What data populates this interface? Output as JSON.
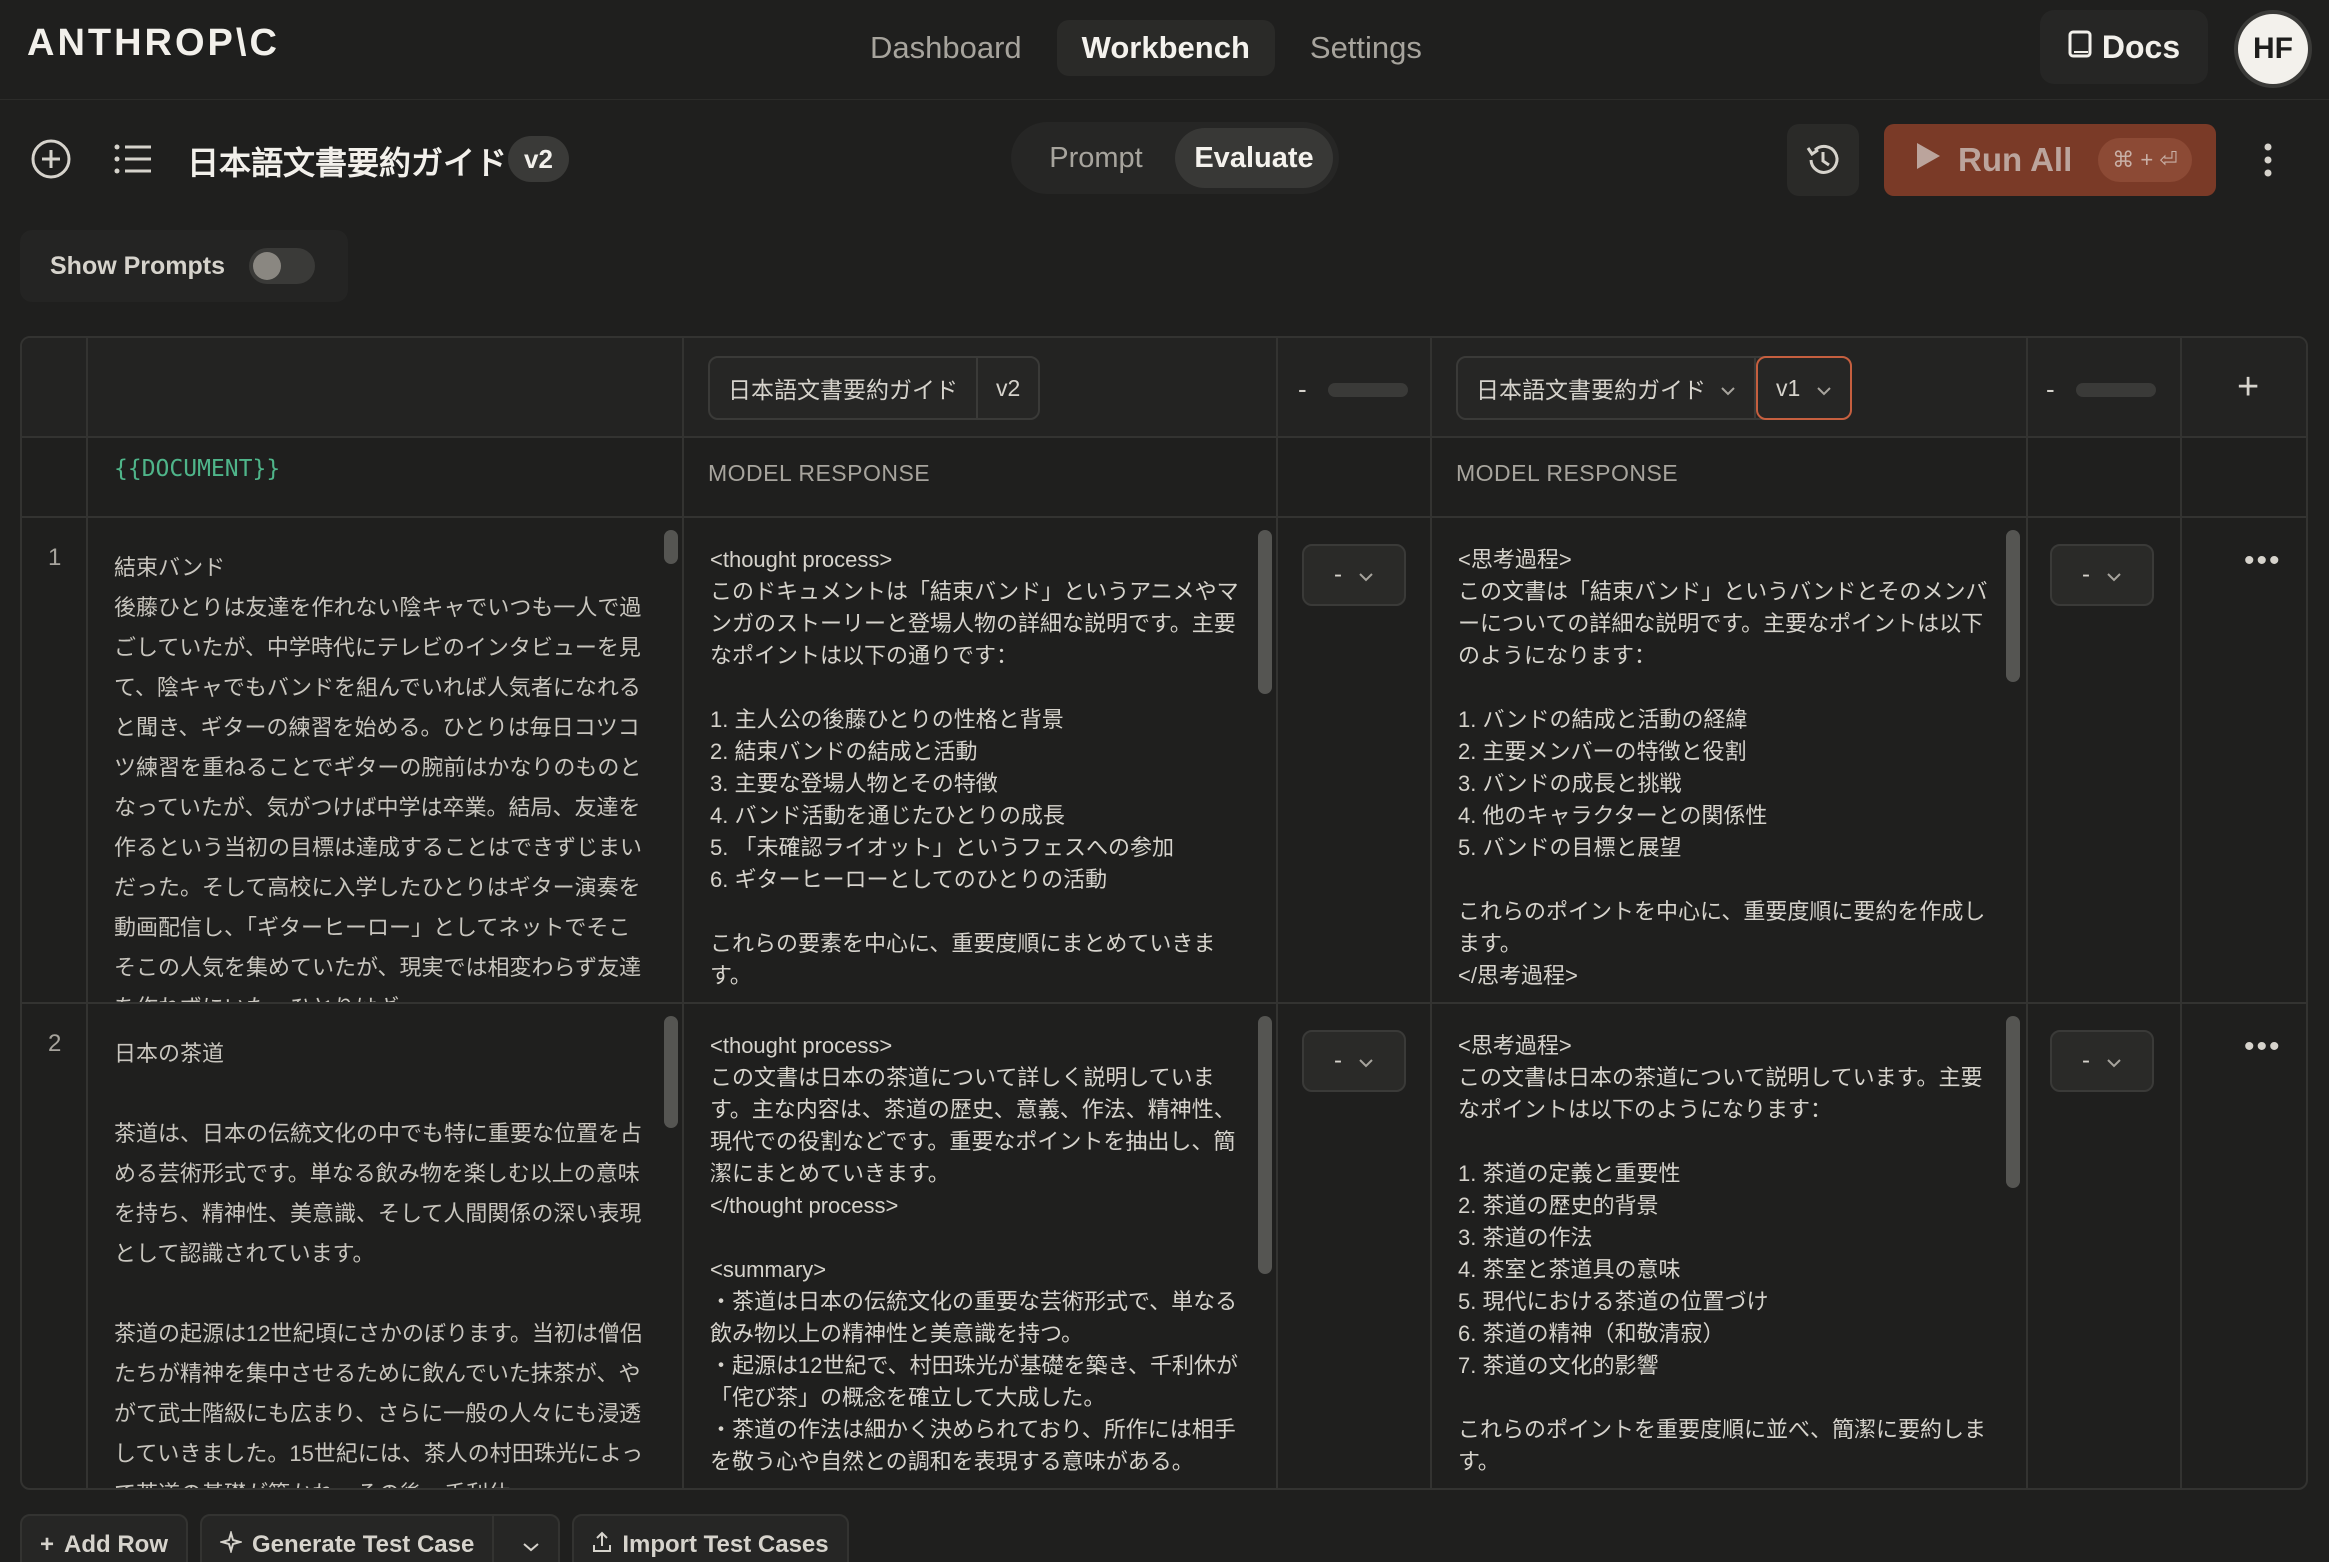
{
  "brand": "ANTHROP\\C",
  "nav": {
    "dashboard": "Dashboard",
    "workbench": "Workbench",
    "settings": "Settings"
  },
  "docs": "Docs",
  "avatar": "HF",
  "toolbar": {
    "title": "日本語文書要約ガイド",
    "version": "v2",
    "tabs": {
      "prompt": "Prompt",
      "evaluate": "Evaluate"
    },
    "run_all": "Run All",
    "shortcut": "⌘ + ⏎"
  },
  "show_prompts": {
    "label": "Show Prompts",
    "enabled": false
  },
  "grid": {
    "variable": "{{DOCUMENT}}",
    "columns": [
      {
        "prompt": "日本語文書要約ガイド",
        "version": "v2",
        "score": "-",
        "header": "MODEL RESPONSE"
      },
      {
        "prompt": "日本語文書要約ガイド",
        "version": "v1",
        "score": "-",
        "header": "MODEL RESPONSE"
      }
    ],
    "rows": [
      {
        "num": "1",
        "document": "結束バンド\n後藤ひとりは友達を作れない陰キャでいつも一人で過ごしていたが、中学時代にテレビのインタビューを見て、陰キャでもバンドを組んでいれば人気者になれると聞き、ギターの練習を始める。ひとりは毎日コツコツ練習を重ねることでギターの腕前はかなりのものとなっていたが、気がつけば中学は卒業。結局、友達を作るという当初の目標は達成することはできずじまいだった。そして高校に入学したひとりはギター演奏を動画配信し、「ギターヒーロー」としてネットでそこそこの人気を集めていたが、現実では相変わらず友達を作れずにいた。ひとりはギ",
        "responses": [
          "<thought process>\nこのドキュメントは「結束バンド」というアニメやマンガのストーリーと登場人物の詳細な説明です。主要なポイントは以下の通りです：\n\n1. 主人公の後藤ひとりの性格と背景\n2. 結束バンドの結成と活動\n3. 主要な登場人物とその特徴\n4. バンド活動を通じたひとりの成長\n5. 「未確認ライオット」というフェスへの参加\n6. ギターヒーローとしてのひとりの活動\n\nこれらの要素を中心に、重要度順にまとめていきます。",
          "<思考過程>\nこの文書は「結束バンド」というバンドとそのメンバーについての詳細な説明です。主要なポイントは以下のようになります：\n\n1. バンドの結成と活動の経緯\n2. 主要メンバーの特徴と役割\n3. バンドの成長と挑戦\n4. 他のキャラクターとの関係性\n5. バンドの目標と展望\n\nこれらのポイントを中心に、重要度順に要約を作成します。\n</思考過程>"
        ],
        "ratings": [
          "-",
          "-"
        ]
      },
      {
        "num": "2",
        "document": "日本の茶道\n\n茶道は、日本の伝統文化の中でも特に重要な位置を占める芸術形式です。単なる飲み物を楽しむ以上の意味を持ち、精神性、美意識、そして人間関係の深い表現として認識されています。\n\n茶道の起源は12世紀頃にさかのぼります。当初は僧侶たちが精神を集中させるために飲んでいた抹茶が、やがて武士階級にも広まり、さらに一般の人々にも浸透していきました。15世紀には、茶人の村田珠光によって茶道の基礎が築かれ、その後、千利休",
        "responses": [
          "<thought process>\nこの文書は日本の茶道について詳しく説明しています。主な内容は、茶道の歴史、意義、作法、精神性、現代での役割などです。重要なポイントを抽出し、簡潔にまとめていきます。\n</thought process>\n\n<summary>\n・茶道は日本の伝統文化の重要な芸術形式で、単なる飲み物以上の精神性と美意識を持つ。\n・起源は12世紀で、村田珠光が基礎を築き、千利休が「侘び茶」の概念を確立して大成した。\n・茶道の作法は細かく決められており、所作には相手を敬う心や自然との調和を表現する意味がある。",
          "<思考過程>\nこの文書は日本の茶道について説明しています。主要なポイントは以下のようになります：\n\n1. 茶道の定義と重要性\n2. 茶道の歴史的背景\n3. 茶道の作法\n4. 茶室と茶道具の意味\n5. 現代における茶道の位置づけ\n6. 茶道の精神（和敬清寂）\n7. 茶道の文化的影響\n\nこれらのポイントを重要度順に並べ、簡潔に要約します。"
        ],
        "ratings": [
          "-",
          "-"
        ]
      }
    ]
  },
  "bottom": {
    "add_row": "Add Row",
    "generate": "Generate Test Case",
    "import": "Import Test Cases"
  }
}
